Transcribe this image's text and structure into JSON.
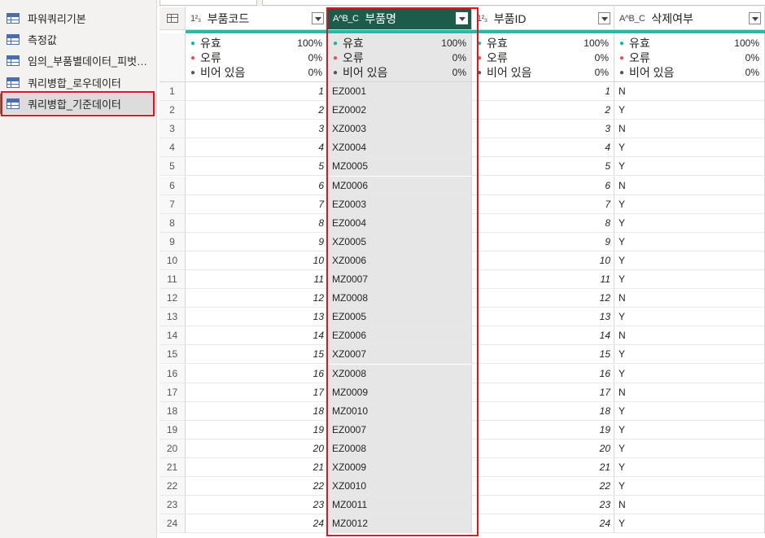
{
  "queries": [
    {
      "label": "파워쿼리기본",
      "selected": false
    },
    {
      "label": "측정값",
      "selected": false
    },
    {
      "label": "임의_부품별데이터_피벗…",
      "selected": false
    },
    {
      "label": "쿼리병합_로우데이터",
      "selected": false
    },
    {
      "label": "쿼리병합_기준데이터",
      "selected": true
    }
  ],
  "columns": [
    {
      "type": "1²₃",
      "name": "부품코드",
      "align": "num",
      "active": false
    },
    {
      "type": "A^B_C",
      "name": "부품명",
      "align": "txt",
      "active": true
    },
    {
      "type": "1²₃",
      "name": "부품ID",
      "align": "num",
      "active": false
    },
    {
      "type": "A^B_C",
      "name": "삭제여부",
      "align": "txt",
      "active": false
    }
  ],
  "quality": {
    "valid_label": "유효",
    "error_label": "오류",
    "empty_label": "비어 있음",
    "columns": [
      {
        "valid": "100%",
        "error": "0%",
        "empty": "0%"
      },
      {
        "valid": "100%",
        "error": "0%",
        "empty": "0%"
      },
      {
        "valid": "100%",
        "error": "0%",
        "empty": "0%"
      },
      {
        "valid": "100%",
        "error": "0%",
        "empty": "0%"
      }
    ]
  },
  "rows": [
    [
      "1",
      "EZ0001",
      "1",
      "N"
    ],
    [
      "2",
      "EZ0002",
      "2",
      "Y"
    ],
    [
      "3",
      "XZ0003",
      "3",
      "N"
    ],
    [
      "4",
      "XZ0004",
      "4",
      "Y"
    ],
    [
      "5",
      "MZ0005",
      "5",
      "Y"
    ],
    [
      "6",
      "MZ0006",
      "6",
      "N"
    ],
    [
      "7",
      "EZ0003",
      "7",
      "Y"
    ],
    [
      "8",
      "EZ0004",
      "8",
      "Y"
    ],
    [
      "9",
      "XZ0005",
      "9",
      "Y"
    ],
    [
      "10",
      "XZ0006",
      "10",
      "Y"
    ],
    [
      "11",
      "MZ0007",
      "11",
      "Y"
    ],
    [
      "12",
      "MZ0008",
      "12",
      "N"
    ],
    [
      "13",
      "EZ0005",
      "13",
      "Y"
    ],
    [
      "14",
      "EZ0006",
      "14",
      "N"
    ],
    [
      "15",
      "XZ0007",
      "15",
      "Y"
    ],
    [
      "16",
      "XZ0008",
      "16",
      "Y"
    ],
    [
      "17",
      "MZ0009",
      "17",
      "N"
    ],
    [
      "18",
      "MZ0010",
      "18",
      "Y"
    ],
    [
      "19",
      "EZ0007",
      "19",
      "Y"
    ],
    [
      "20",
      "EZ0008",
      "20",
      "Y"
    ],
    [
      "21",
      "XZ0009",
      "21",
      "Y"
    ],
    [
      "22",
      "XZ0010",
      "22",
      "Y"
    ],
    [
      "23",
      "MZ0011",
      "23",
      "N"
    ],
    [
      "24",
      "MZ0012",
      "24",
      "Y"
    ]
  ],
  "colors": {
    "active_header": "#1b5d4a",
    "quality_bar": "#2bb6a8",
    "highlight_box": "#e0141e",
    "selected_column": "#e6e6e6"
  }
}
